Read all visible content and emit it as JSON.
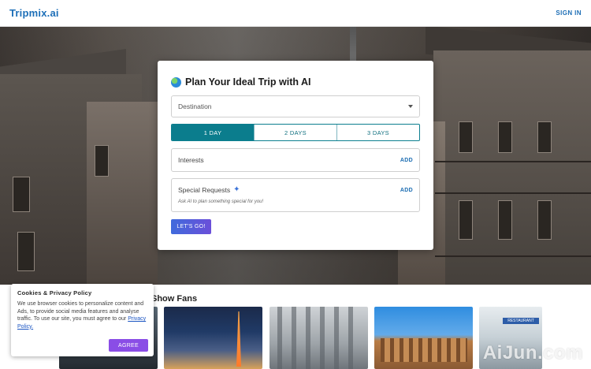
{
  "header": {
    "logo": "Tripmix.ai",
    "signin": "SIGN IN"
  },
  "planner": {
    "title": "Plan Your Ideal Trip with AI",
    "destination_placeholder": "Destination",
    "days": [
      {
        "label": "1 DAY",
        "active": true
      },
      {
        "label": "2 DAYS",
        "active": false
      },
      {
        "label": "3 DAYS",
        "active": false
      }
    ],
    "interests_label": "Interests",
    "interests_add": "ADD",
    "special_label": "Special Requests",
    "special_add": "ADD",
    "special_hint": "Ask AI to plan something special for you!",
    "go_label": "LET'S GO!"
  },
  "gallery": {
    "title": "Show Fans",
    "restaurant_sign": "RESTAURANT"
  },
  "cookie": {
    "title": "Cookies & Privacy Policy",
    "text": "We use browser cookies to personalize content and Ads, to provide social media features and analyse traffic. To use our site, you must agree to our",
    "link": "Privacy Policy.",
    "agree": "AGREE"
  },
  "watermark": "AiJun.com",
  "colors": {
    "accent": "#0b7d8d",
    "logo": "#1d6fb8",
    "button_gradient_start": "#3f6bdc",
    "button_gradient_end": "#6b4fd9",
    "agree": "#8a4de6"
  }
}
